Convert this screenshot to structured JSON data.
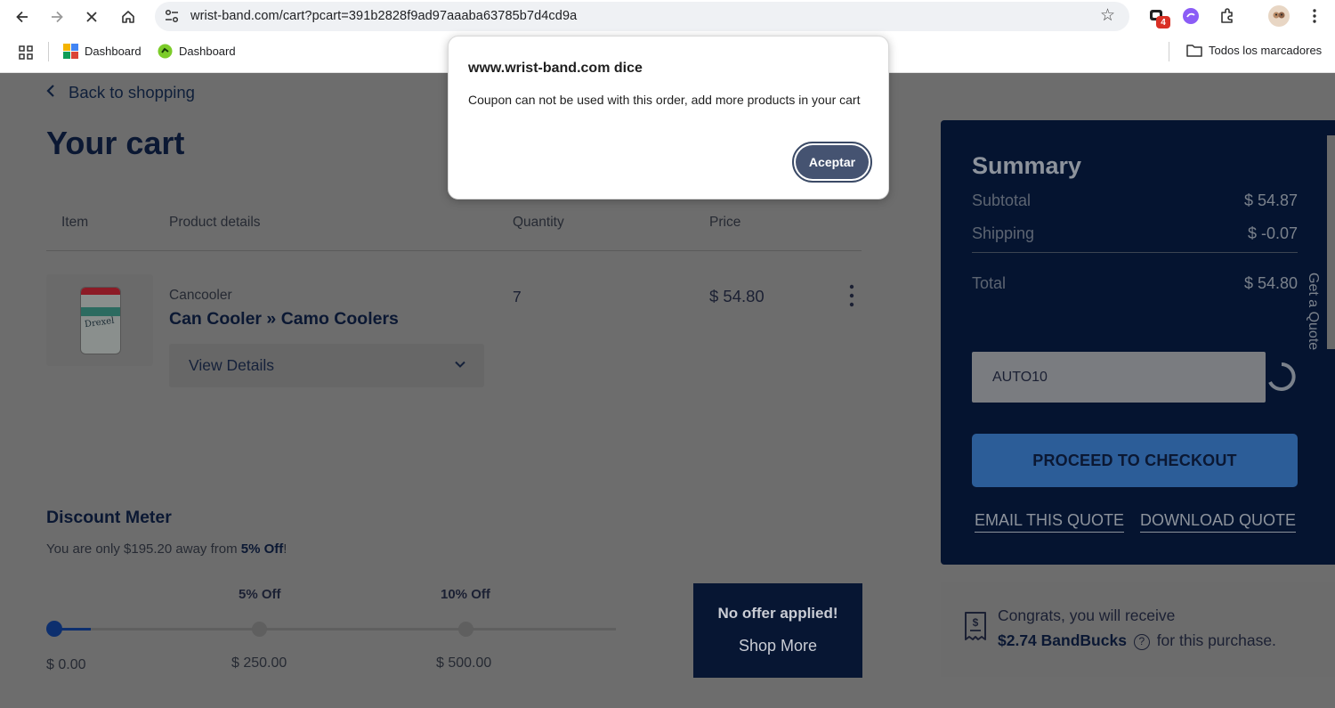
{
  "browser": {
    "url": "wrist-band.com/cart?pcart=391b2828f9ad97aaaba63785b7d4cd9a",
    "extension_badge": "4",
    "bookmarks": [
      {
        "label": "Dashboard",
        "icon": "colorful-grid-icon"
      },
      {
        "label": "Dashboard",
        "icon": "green-logo-icon"
      }
    ],
    "all_bookmarks": "Todos los marcadores"
  },
  "dialog": {
    "heading": "www.wrist-band.com dice",
    "message": "Coupon can not be used with this order, add more products in your cart",
    "ok_label": "Aceptar"
  },
  "cart": {
    "back_label": "Back to shopping",
    "title": "Your cart",
    "headers": {
      "item": "Item",
      "details": "Product details",
      "quantity": "Quantity",
      "price": "Price"
    },
    "items": [
      {
        "category": "Cancooler",
        "name": "Can Cooler » Camo Coolers",
        "details_label": "View Details",
        "quantity": "7",
        "price": "$ 54.80",
        "image_text": "Drexel"
      }
    ]
  },
  "discount_meter": {
    "title": "Discount Meter",
    "subtitle_prefix": "You are only $195.20 away from ",
    "subtitle_bold": "5% Off",
    "subtitle_suffix": "!",
    "milestones": [
      {
        "label": "",
        "amount": "$ 0.00"
      },
      {
        "label": "5% Off",
        "amount": "$ 250.00"
      },
      {
        "label": "10% Off",
        "amount": "$ 500.00"
      }
    ],
    "offer_line1": "No offer applied!",
    "offer_line2": "Shop More"
  },
  "summary": {
    "title": "Summary",
    "subtotal_label": "Subtotal",
    "subtotal_value": "$ 54.87",
    "shipping_label": "Shipping",
    "shipping_value": "$ -0.07",
    "total_label": "Total",
    "total_value": "$ 54.80",
    "coupon_value": "AUTO10",
    "checkout_label": "PROCEED TO CHECKOUT",
    "email_quote": "EMAIL THIS QUOTE",
    "download_quote": "DOWNLOAD QUOTE",
    "side_tab": "Get a Quote"
  },
  "bandbucks": {
    "line1": "Congrats, you will receive",
    "amount": "$2.74 BandBucks",
    "line2_suffix": "for this purchase."
  }
}
